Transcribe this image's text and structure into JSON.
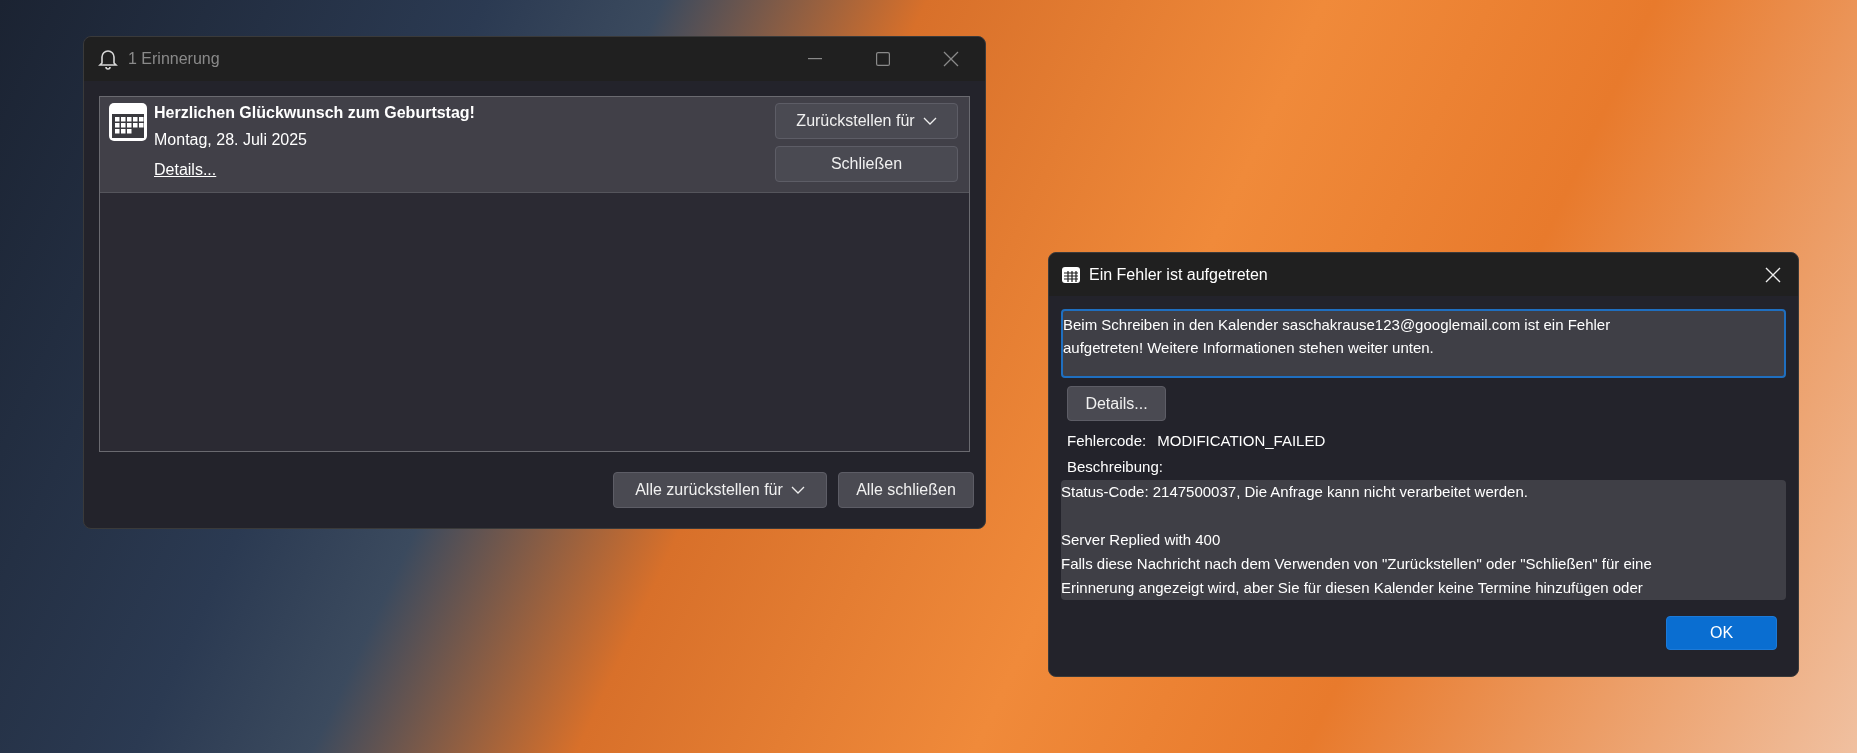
{
  "reminder_window": {
    "title": "1 Erinnerung",
    "reminders": [
      {
        "title": "Herzlichen Glückwunsch zum Geburtstag!",
        "date": "Montag, 28. Juli 2025",
        "details_link": "Details...",
        "snooze_button": "Zurückstellen für",
        "dismiss_button": "Schließen",
        "selected": true
      }
    ],
    "snooze_all_button": "Alle zurückstellen für",
    "dismiss_all_button": "Alle schließen"
  },
  "error_dialog": {
    "title": "Ein Fehler ist aufgetreten",
    "message": [
      "Beim Schreiben in den Kalender saschakrause123@googlemail.com ist ein Fehler",
      "aufgetreten! Weitere Informationen stehen weiter unten."
    ],
    "details_button": "Details...",
    "error_code_label": "Fehlercode:",
    "error_code": "MODIFICATION_FAILED",
    "description_label": "Beschreibung:",
    "description": [
      [
        "Status-Code: 2147500037, Die Anfrage kann nicht verarbeitet werden."
      ],
      [
        "Server Replied with 400",
        "Falls diese Nachricht nach dem Verwenden von \"Zurückstellen\" oder \"Schließen\" für eine",
        "Erinnerung angezeigt wird, aber Sie für diesen Kalender keine Termine hinzufügen oder"
      ]
    ],
    "ok_button": "OK"
  }
}
